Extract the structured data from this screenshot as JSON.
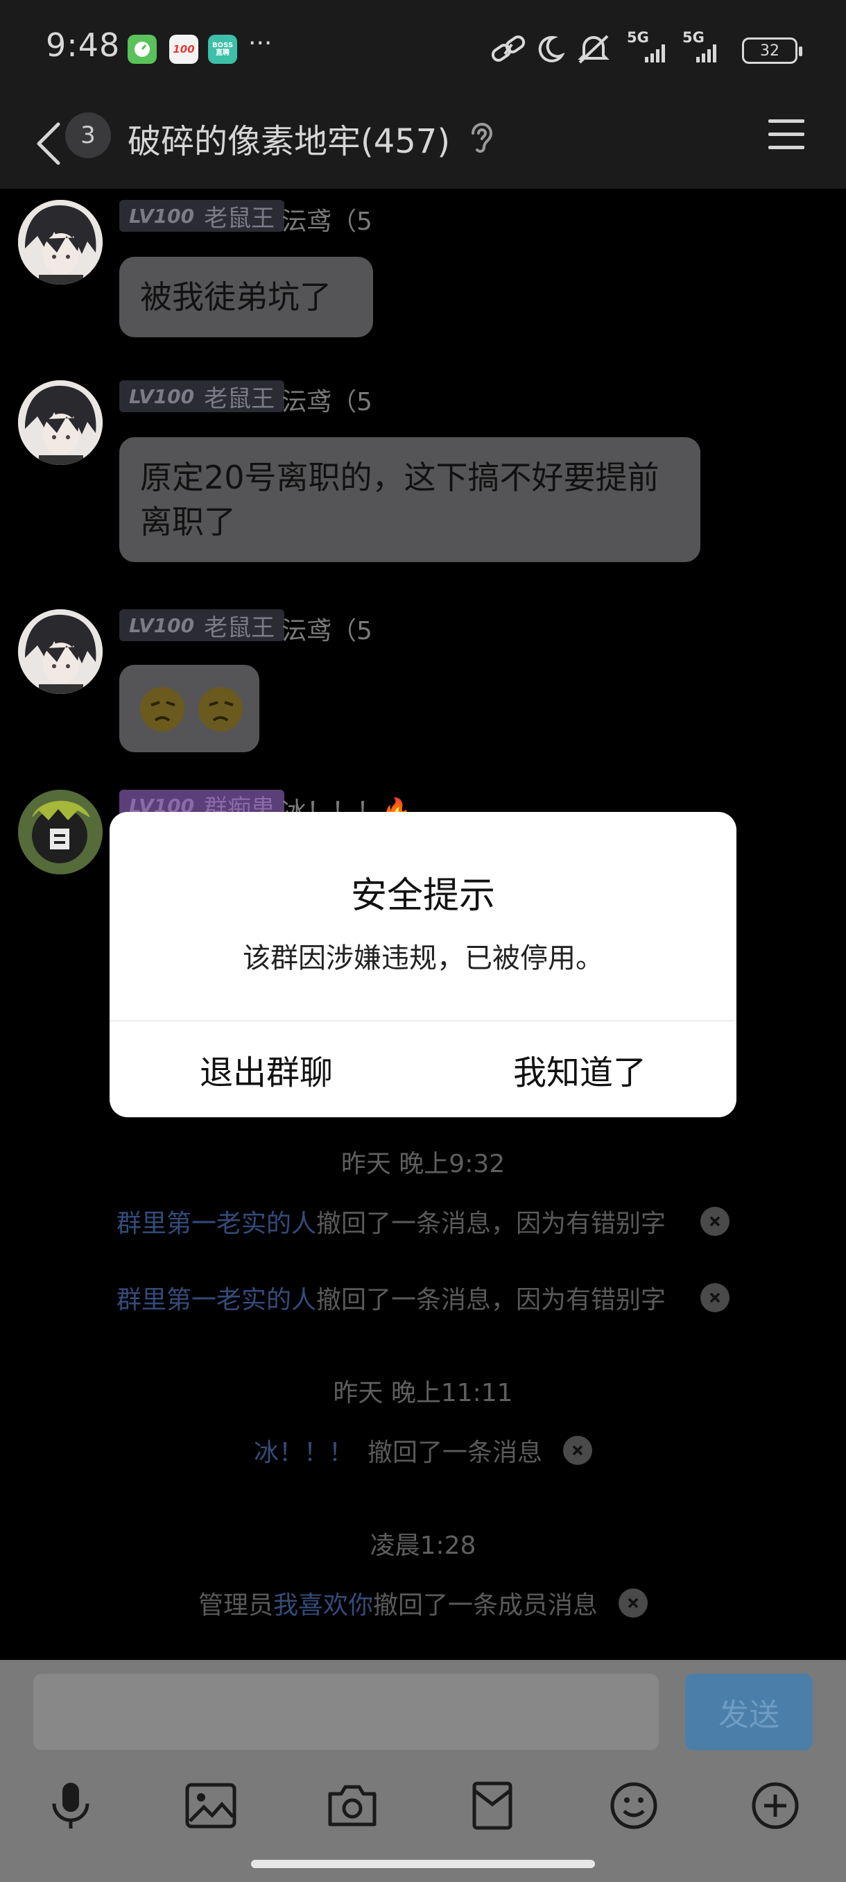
{
  "status_bar": {
    "time": "9:48",
    "apps": [
      "timer-app-icon",
      "100-app-icon",
      "boss-zhipin-app-icon"
    ],
    "boss_label": "BOSS\n直聘",
    "app_100_label": "100",
    "more": "···",
    "network_1": "5G",
    "network_2": "5G",
    "battery": "32"
  },
  "header": {
    "unread_count": "3",
    "title": "破碎的像素地牢(457)"
  },
  "messages": [
    {
      "level": "LV100",
      "title": "老鼠王",
      "sender": "沄鸢（5",
      "text": "被我徒弟坑了"
    },
    {
      "level": "LV100",
      "title": "老鼠王",
      "sender": "沄鸢（5",
      "text": "原定20号离职的，这下搞不好要提前离职了"
    },
    {
      "level": "LV100",
      "title": "老鼠王",
      "sender": "沄鸢（5",
      "text": "😟😟"
    },
    {
      "level": "LV100",
      "title": "群痴患",
      "sender": "冰！！！🔥"
    }
  ],
  "system": {
    "time_1": "昨天 晚上9:32",
    "recall_1_user": "群里第一老实的人",
    "recall_1_text": "撤回了一条消息，因为有错别字",
    "recall_2_user": "群里第一老实的人",
    "recall_2_text": "撤回了一条消息，因为有错别字",
    "time_2": "昨天 晚上11:11",
    "recall_3_user": "冰！！！",
    "recall_3_text": "撤回了一条消息",
    "time_3": "凌晨1:28",
    "recall_4_prefix": "管理员",
    "recall_4_user": "我喜欢你",
    "recall_4_text": "撤回了一条成员消息"
  },
  "dialog": {
    "title": "安全提示",
    "message": "该群因涉嫌违规，已被停用。",
    "exit_label": "退出群聊",
    "ok_label": "我知道了"
  },
  "input_bar": {
    "placeholder": "",
    "send_label": "发送",
    "tools": [
      "microphone-icon",
      "image-icon",
      "camera-icon",
      "red-packet-icon",
      "emoji-icon",
      "plus-icon"
    ]
  },
  "colors": {
    "link": "#344b7a",
    "send_button": "#4b7fa9",
    "dialog_bg": "#ffffff"
  }
}
